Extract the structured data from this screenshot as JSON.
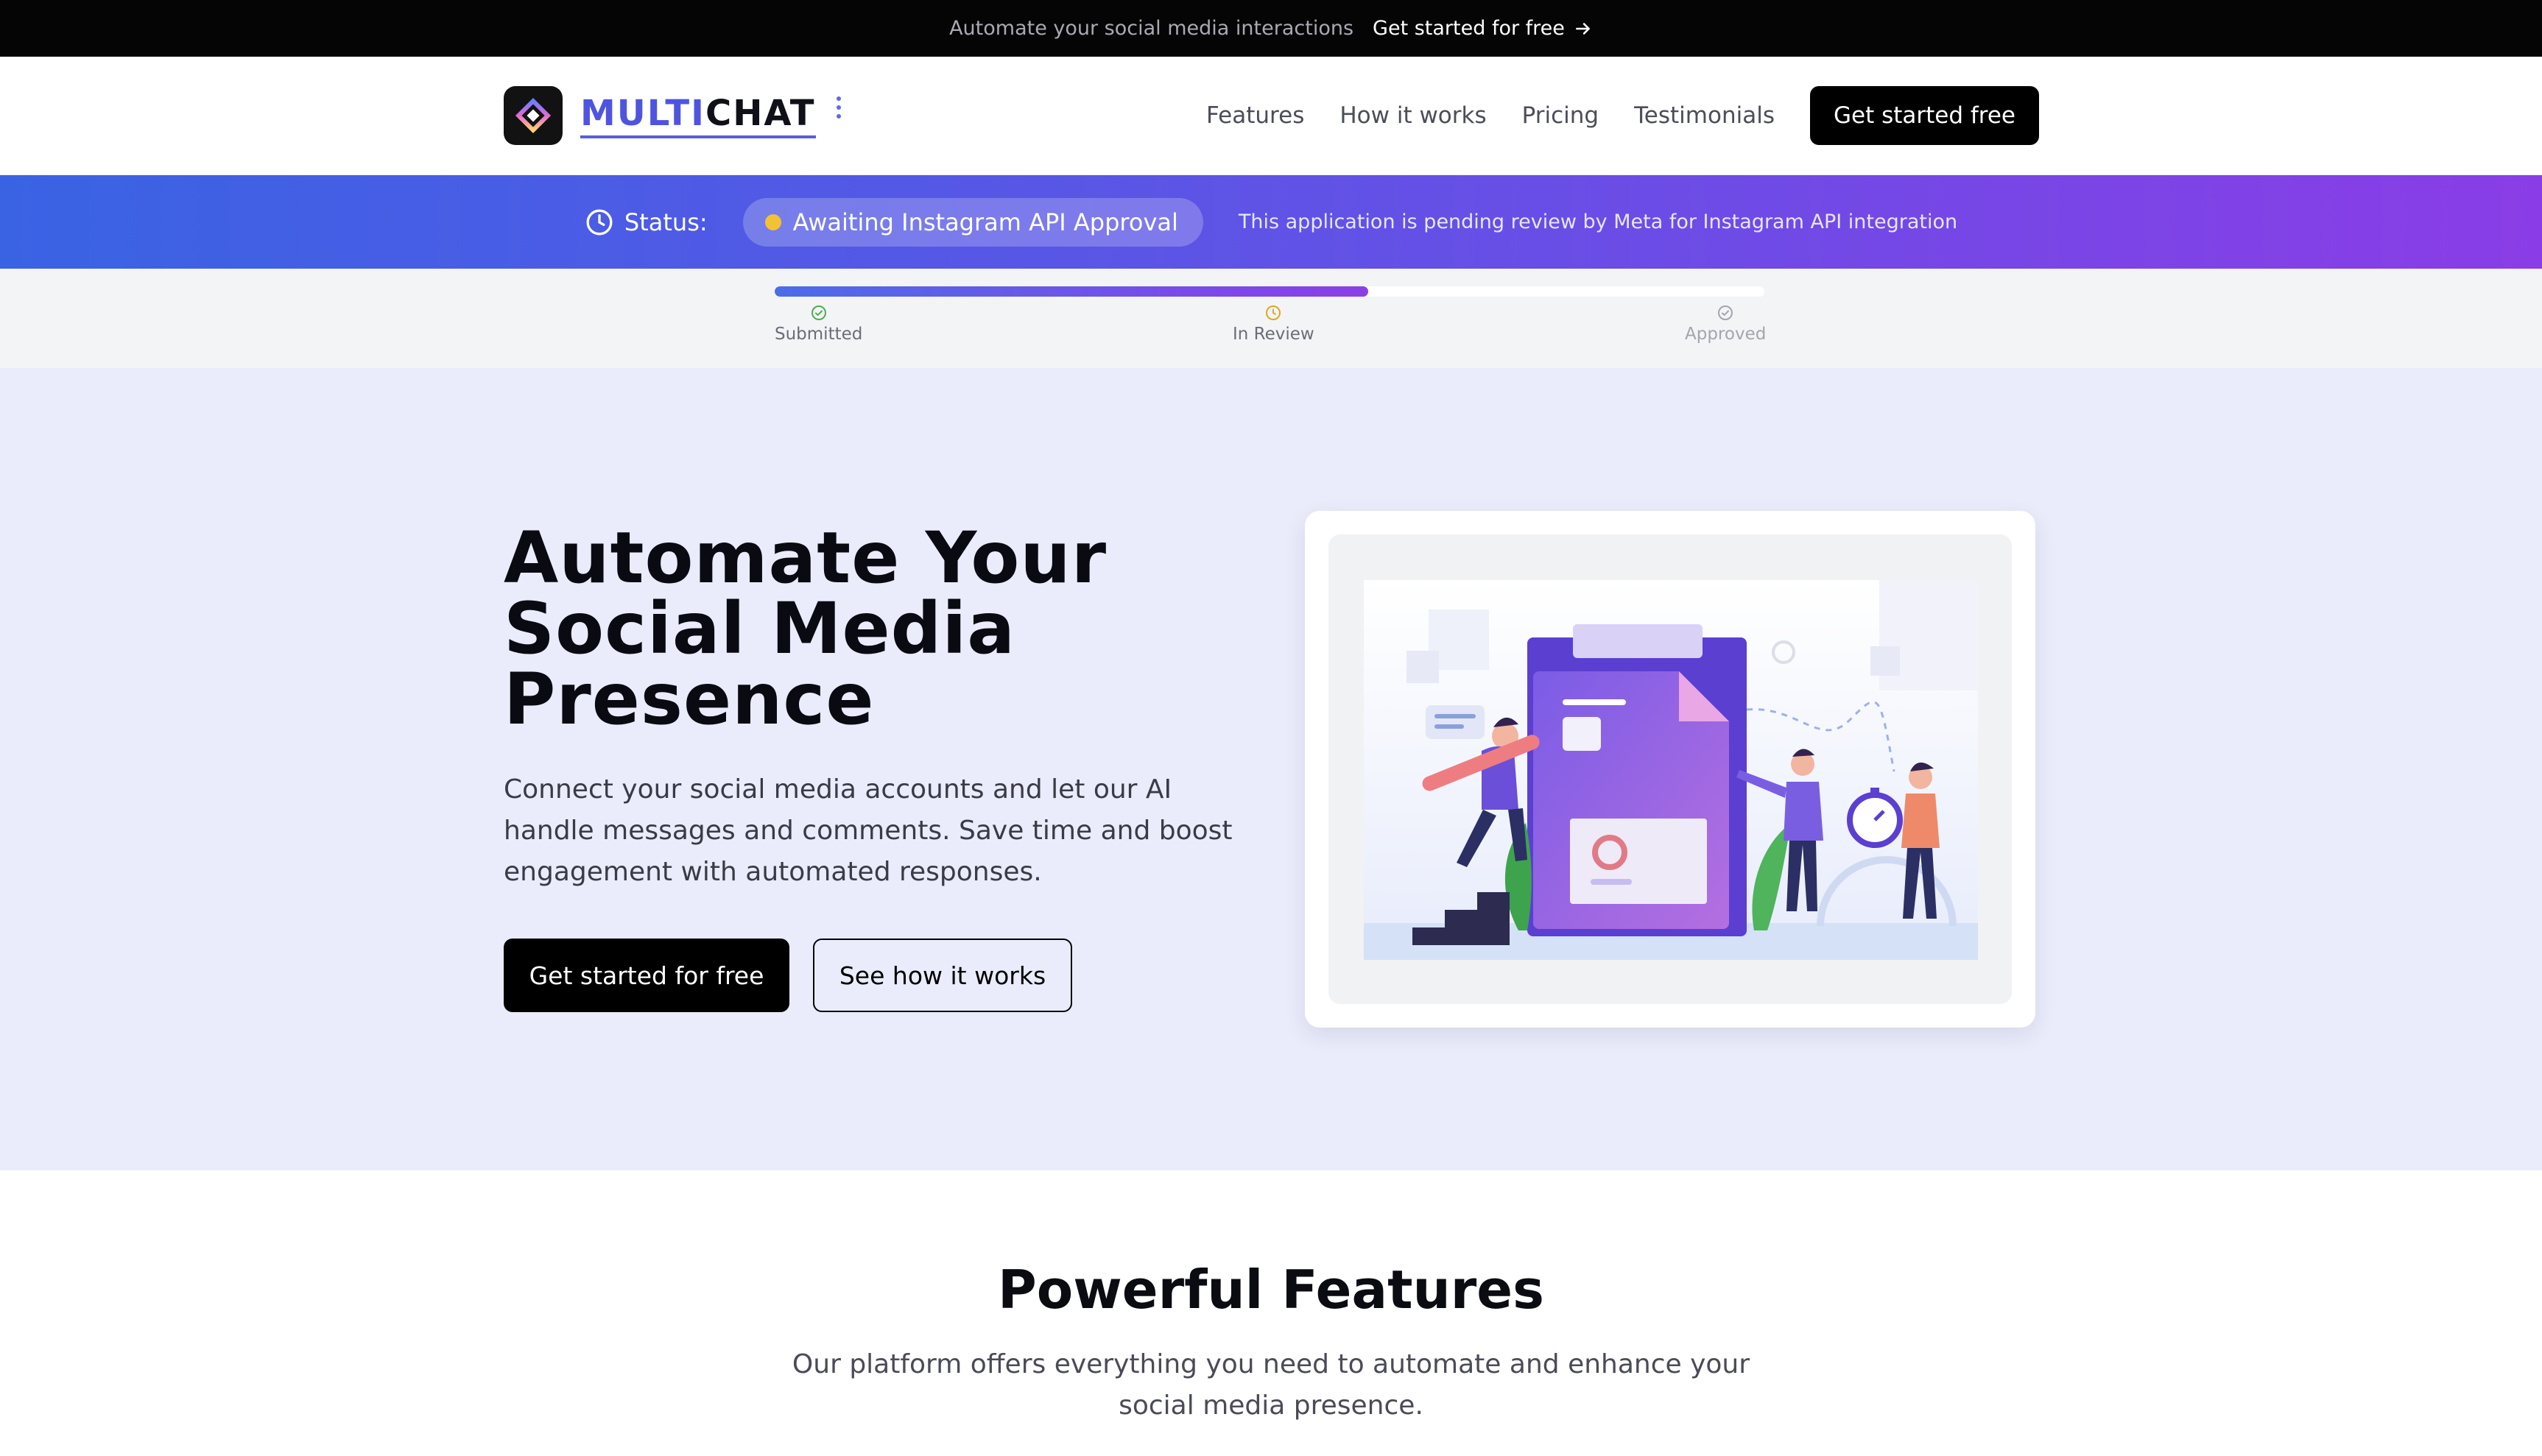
{
  "announcement": {
    "message": "Automate your social media interactions",
    "cta_label": "Get started for free",
    "cta_icon": "arrow-right-icon"
  },
  "header": {
    "brand_part1": "MULTI",
    "brand_part2": "CHAT",
    "logo_icon": "multichat-logo",
    "nav": {
      "features": "Features",
      "how_it_works": "How it works",
      "pricing": "Pricing",
      "testimonials": "Testimonials"
    },
    "cta_label": "Get started free"
  },
  "status": {
    "label": "Status:",
    "icon": "clock-icon",
    "badge": "Awaiting Instagram API Approval",
    "badge_dot_color": "#f2c232",
    "note": "This application is pending review by Meta for Instagram API integration",
    "gradient_start": "#3a63e4",
    "gradient_end": "#8a3de6"
  },
  "progress": {
    "fraction": 0.6,
    "steps": [
      {
        "label": "Submitted",
        "state": "done",
        "icon": "check-circle-icon"
      },
      {
        "label": "In Review",
        "state": "current",
        "icon": "clock-icon"
      },
      {
        "label": "Approved",
        "state": "pending",
        "icon": "check-circle-icon"
      }
    ]
  },
  "hero": {
    "title_line1": "Automate Your",
    "title_line2": "Social Media",
    "title_line3": "Presence",
    "lede": "Connect your social media accounts and let our AI handle messages and comments. Save time and boost engagement with automated responses.",
    "primary_cta": "Get started for free",
    "secondary_cta": "See how it works",
    "illustration": "team-planning-illustration"
  },
  "features": {
    "title": "Powerful Features",
    "subtitle": "Our platform offers everything you need to automate and enhance your social media presence."
  }
}
